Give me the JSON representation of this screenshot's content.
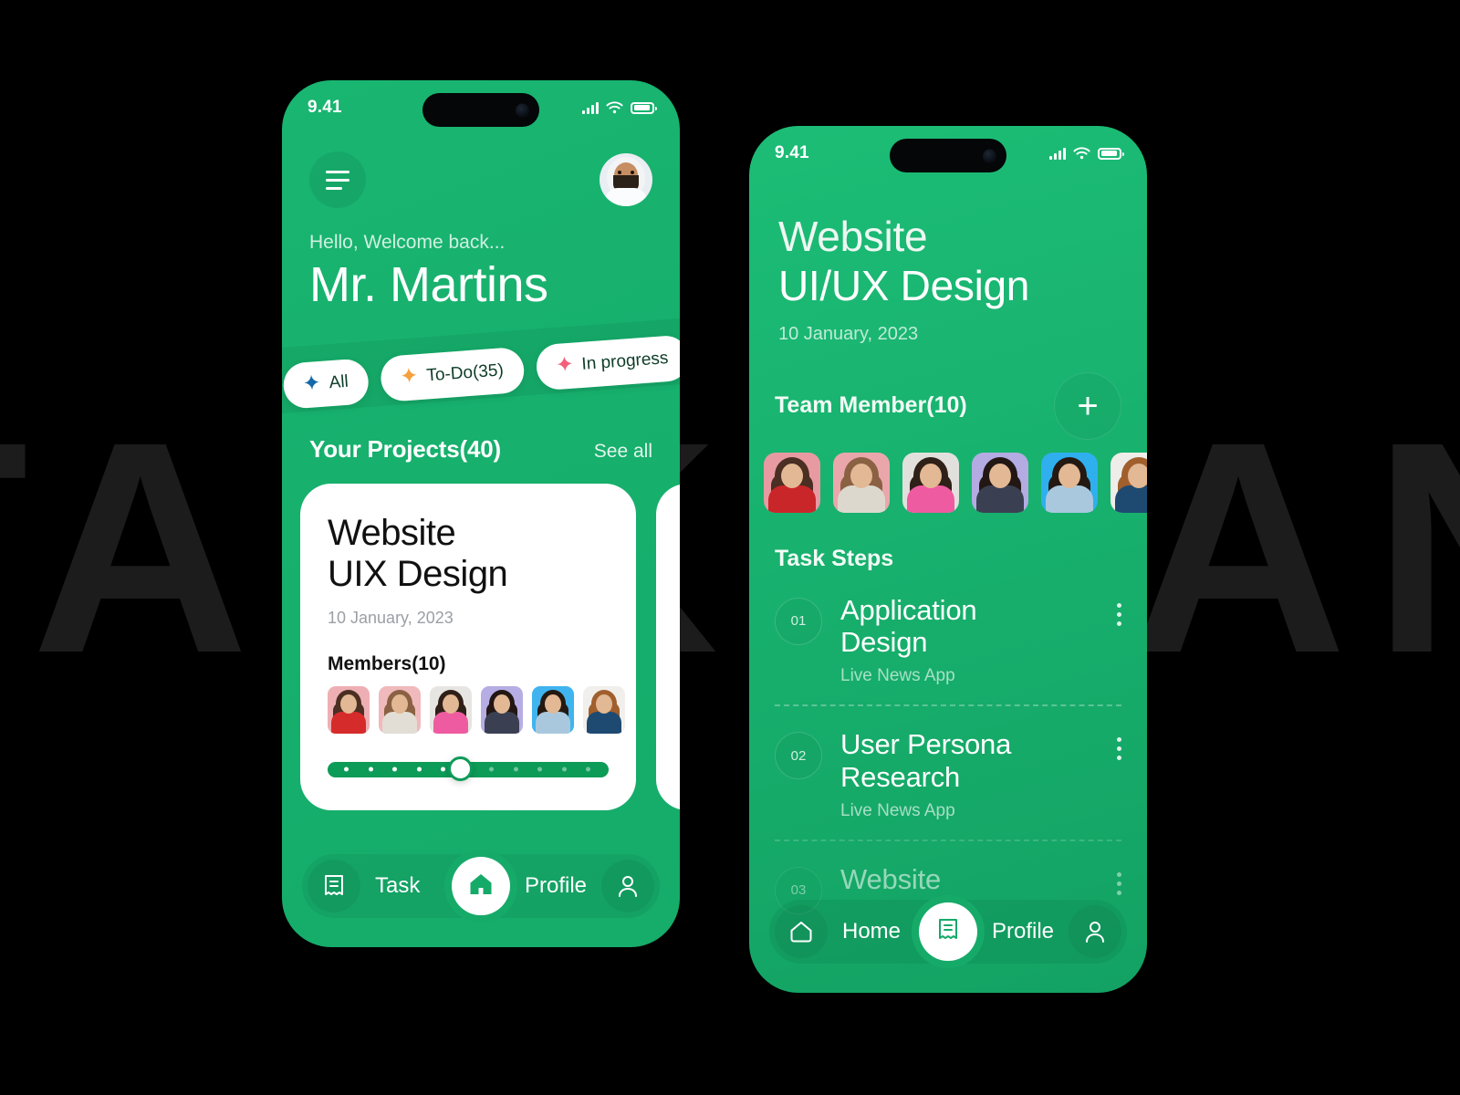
{
  "background": {
    "watermark": "TASK MAN"
  },
  "phone1": {
    "status": {
      "time": "9.41",
      "icons": [
        "cell-signal-icon",
        "wifi-icon",
        "battery-icon"
      ]
    },
    "header": {
      "menu_icon": "hamburger-menu-icon",
      "avatar": "user-avatar"
    },
    "greeting": {
      "hello": "Hello, Welcome back...",
      "name": "Mr. Martins"
    },
    "filters": [
      {
        "label": "All",
        "color": "#1669a8",
        "icon": "sparkle-icon"
      },
      {
        "label": "To-Do(35)",
        "color": "#f5a13f",
        "icon": "sparkle-icon"
      },
      {
        "label": "In progress",
        "color": "#f4607a",
        "icon": "sparkle-icon"
      },
      {
        "label": "",
        "color": "#7cc46b",
        "icon": "sparkle-icon"
      }
    ],
    "section": {
      "title": "Your Projects(40)",
      "link": "See all"
    },
    "cards": [
      {
        "title_line1": "Website",
        "title_line2": "UIX Design",
        "date": "10 January, 2023",
        "members_label": "Members(10)",
        "add_icon": "plus-icon",
        "members": [
          {
            "bg": "#eeafb4",
            "body": "#d62b2b",
            "hair": "#4a2f22"
          },
          {
            "bg": "#f0b9bc",
            "body": "#e2ded5",
            "hair": "#8a6142"
          },
          {
            "bg": "#e7e5e2",
            "body": "#ef5ba0",
            "hair": "#2f2018"
          },
          {
            "bg": "#b5ade3",
            "body": "#3a4052",
            "hair": "#221713"
          },
          {
            "bg": "#3fb4ef",
            "body": "#a9c8de",
            "hair": "#241912"
          },
          {
            "bg": "#f1efec",
            "body": "#1e4a72",
            "hair": "#a05f2d"
          }
        ],
        "progress": {
          "value": 43,
          "dots_filled": 5,
          "dots_total": 11
        }
      },
      {
        "title_line1": "",
        "title_line2": "",
        "date": "",
        "members_label": "",
        "add_icon": "plus-icon",
        "members": [],
        "progress": {
          "value": 0,
          "dots_filled": 0,
          "dots_total": 11
        }
      }
    ],
    "bottom_nav": {
      "left": {
        "label": "Task",
        "icon": "task-receipt-icon"
      },
      "center": {
        "icon": "home-icon",
        "active": true
      },
      "right": {
        "label": "Profile",
        "icon": "person-icon"
      }
    }
  },
  "phone2": {
    "status": {
      "time": "9.41",
      "icons": [
        "cell-signal-icon",
        "wifi-icon",
        "battery-icon"
      ]
    },
    "title": {
      "line1": "Website",
      "line2": "UI/UX Design",
      "date": "10 January, 2023"
    },
    "team": {
      "label": "Team Member(10)",
      "add_icon": "plus-icon",
      "members": [
        {
          "bg": "#e79aa1",
          "body": "#c9262a",
          "hair": "#4a2f22"
        },
        {
          "bg": "#eaa7ab",
          "body": "#ddd8ce",
          "hair": "#8a6142"
        },
        {
          "bg": "#e2e0dd",
          "body": "#ef5ba0",
          "hair": "#2f2018"
        },
        {
          "bg": "#b3abe2",
          "body": "#3a4052",
          "hair": "#221713"
        },
        {
          "bg": "#2fafee",
          "body": "#a9c8de",
          "hair": "#241912"
        },
        {
          "bg": "#efedea",
          "body": "#1e4a72",
          "hair": "#a05f2d"
        }
      ]
    },
    "task_steps": {
      "label": "Task Steps",
      "items": [
        {
          "num": "01",
          "title": "Application Design",
          "sub": "Live News App",
          "menu_icon": "kebab-menu-icon"
        },
        {
          "num": "02",
          "title": "User Persona Research",
          "sub": "Live News App",
          "menu_icon": "kebab-menu-icon"
        },
        {
          "num": "03",
          "title": "Website",
          "sub": "",
          "menu_icon": "kebab-menu-icon"
        }
      ]
    },
    "bottom_nav": {
      "left": {
        "label": "Home",
        "icon": "home-outline-icon"
      },
      "center": {
        "icon": "task-receipt-icon",
        "active": true
      },
      "right": {
        "label": "Profile",
        "icon": "person-icon"
      }
    }
  },
  "colors": {
    "brand_green": "#18b46f",
    "dark_green": "#0d9b58",
    "card_white": "#ffffff",
    "bg_black": "#000000"
  }
}
